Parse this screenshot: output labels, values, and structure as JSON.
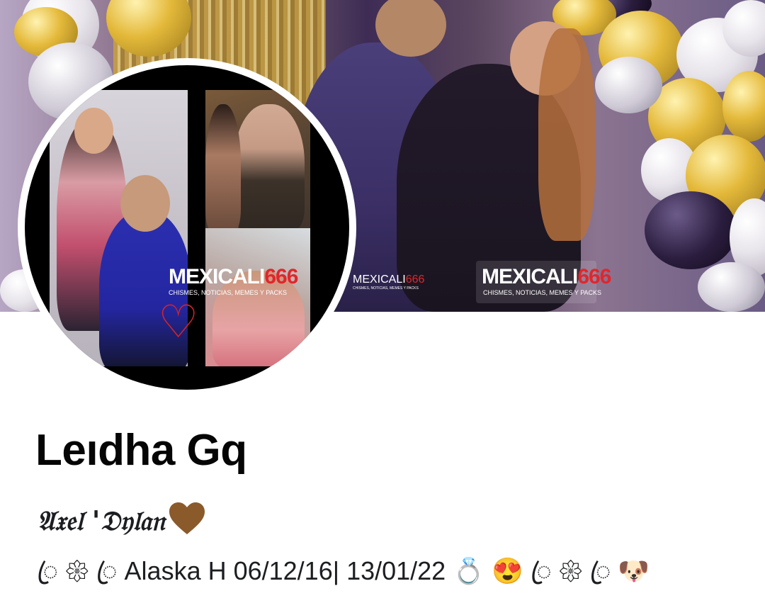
{
  "profile": {
    "name": "Leıdha Gq",
    "subtitle": "𝔄𝔵𝔢𝔩 '𝔇𝔶𝔩𝔞𝔫",
    "bio": "ꦿ 𑁍 ꦿ  Alaska H 06/12/16| 13/01/22 💍 😍 ꦿ 𑁍 ꦿ 🐶"
  },
  "watermark": {
    "brand": "MEXICALI",
    "number": "666",
    "tagline": "CHISMES, NOTICIAS, MEMES Y PACKS"
  },
  "colors": {
    "brand_red": "#e1262c",
    "text": "#050505",
    "background": "#ffffff",
    "heart_brown": "#8b5a2b"
  }
}
